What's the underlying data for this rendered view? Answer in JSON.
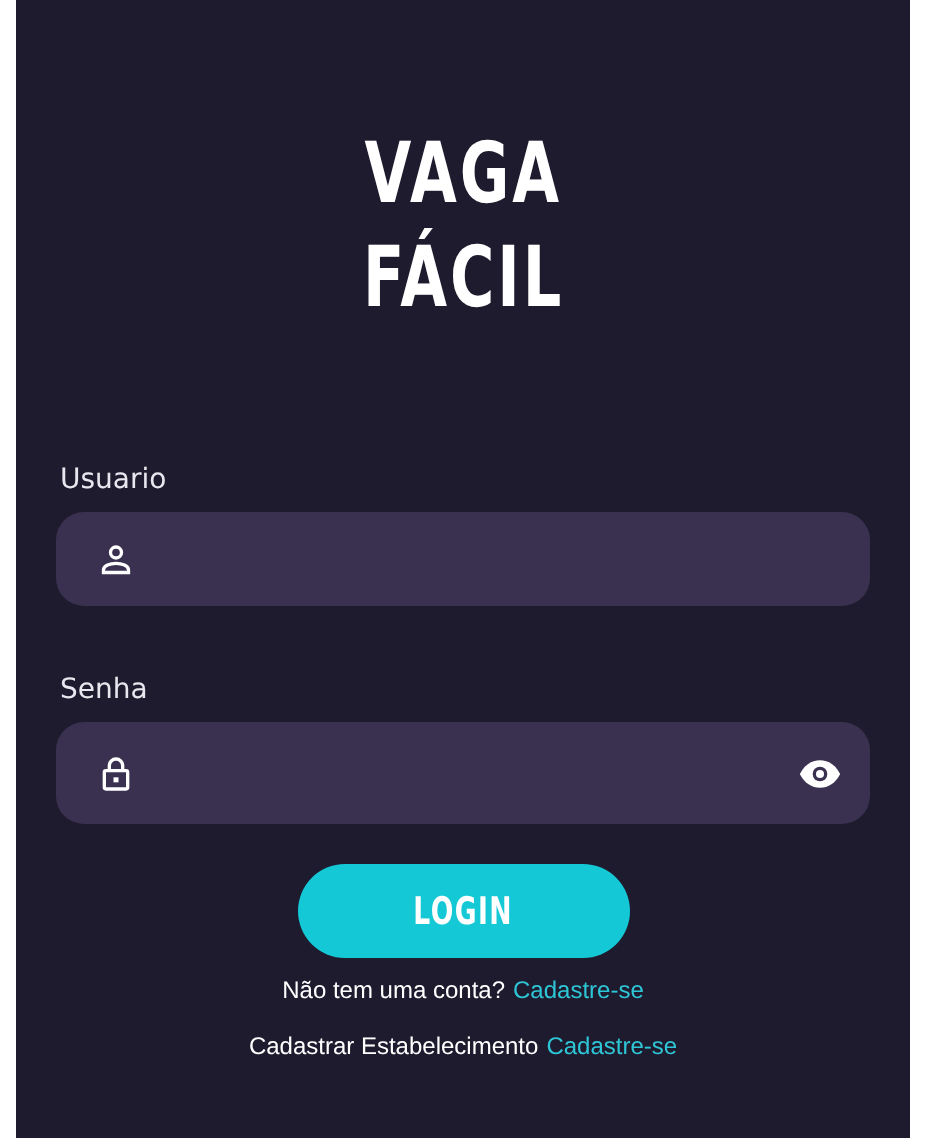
{
  "logo": {
    "lines": [
      "VAGA",
      "FÁCIL"
    ]
  },
  "fields": [
    {
      "label": "Usuario",
      "kind": "text"
    },
    {
      "label": "Senha",
      "kind": "password"
    }
  ],
  "login_button": "LOGIN",
  "links": [
    {
      "text": "Não tem uma conta?",
      "link": "Cadastre-se"
    },
    {
      "text": "Cadastrar Estabelecimento",
      "link": "Cadastre-se"
    }
  ]
}
